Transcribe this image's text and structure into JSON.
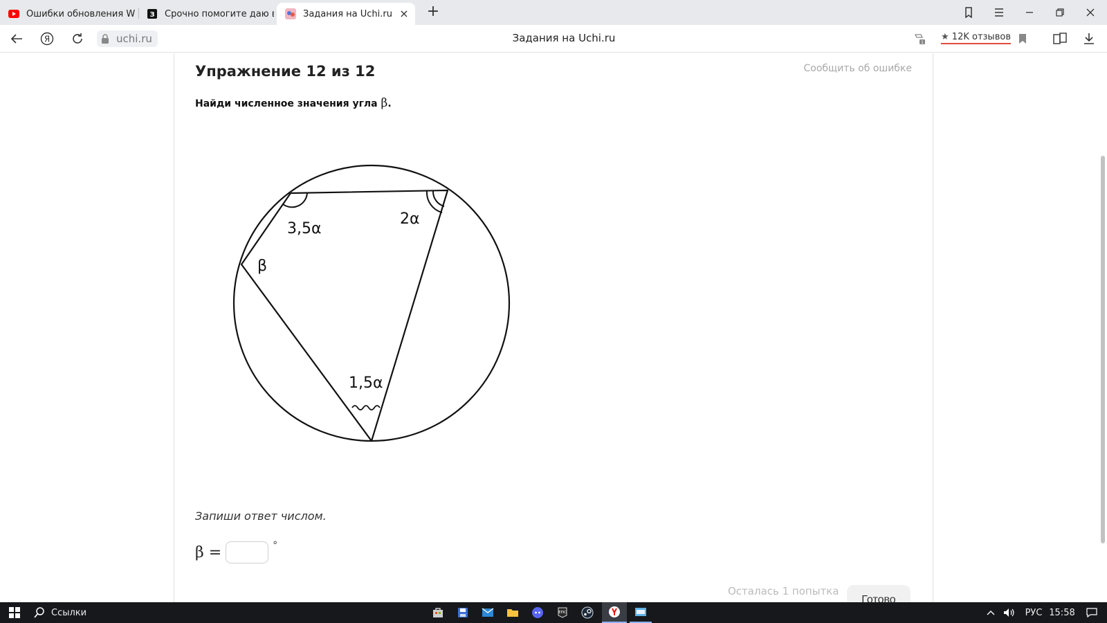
{
  "browser": {
    "tabs": [
      {
        "title": "Ошибки обновления Win",
        "favicon": "youtube-icon",
        "active": false
      },
      {
        "title": "Срочно помогите даю все",
        "favicon": "znanija-icon",
        "active": false
      },
      {
        "title": "Задания на Uchi.ru",
        "favicon": "uchi-icon",
        "active": true
      }
    ],
    "url": "uchi.ru",
    "page_title": "Задания на Uchi.ru",
    "reviews_label": "12K отзывов"
  },
  "content": {
    "exercise_title": "Упражнение 12 из 12",
    "report_link": "Сообщить об ошибке",
    "task_text": "Найди численное значения угла ",
    "task_symbol": "β",
    "task_end": ".",
    "figure_labels": {
      "angle_top_left": "3,5α",
      "angle_top_right": "2α",
      "angle_left": "β",
      "angle_bottom": "1,5α"
    },
    "hint": "Запиши ответ числом.",
    "answer_prefix": "β =",
    "answer_value": "",
    "answer_suffix": "°",
    "attempts_text": "Осталась 1 попытка",
    "done_button": "Готово"
  },
  "taskbar": {
    "links_label": "Ссылки",
    "language": "РУС",
    "time": "15:58"
  },
  "colors": {
    "tabbar_bg": "#e8e9ec",
    "taskbar_bg": "#16181c",
    "reviews_underline": "#e14c3d"
  }
}
